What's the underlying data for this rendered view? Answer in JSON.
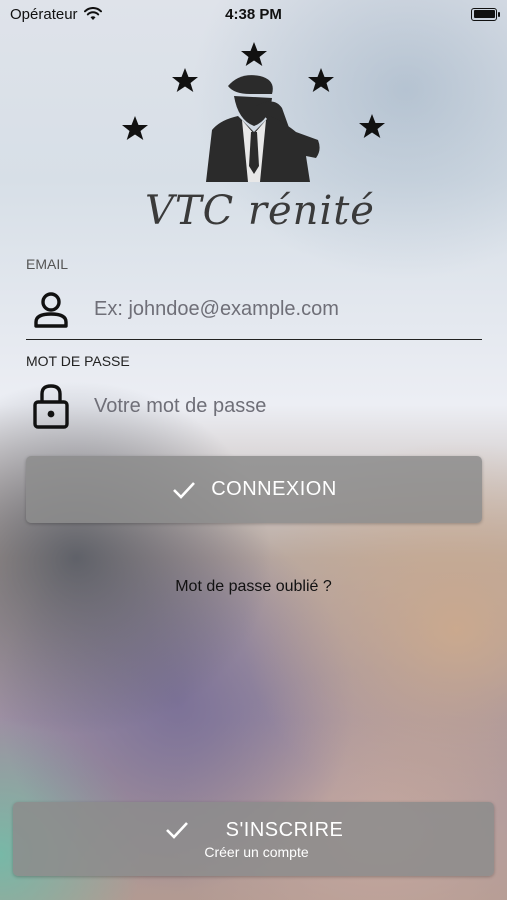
{
  "status_bar": {
    "carrier": "Opérateur",
    "time": "4:38 PM"
  },
  "logo": {
    "text": "VTC rénité"
  },
  "email": {
    "label": "EMAIL",
    "placeholder": "Ex: johndoe@example.com"
  },
  "password": {
    "label": "MOT DE PASSE",
    "placeholder": "Votre mot de passe"
  },
  "login_button": {
    "label": "CONNEXION"
  },
  "forgot_link": "Mot de passe oublié ?",
  "signup_button": {
    "label": "S'INSCRIRE",
    "sublabel": "Créer un compte"
  },
  "colors": {
    "button_bg": "#8c8c8c",
    "text_dark": "#111111"
  }
}
